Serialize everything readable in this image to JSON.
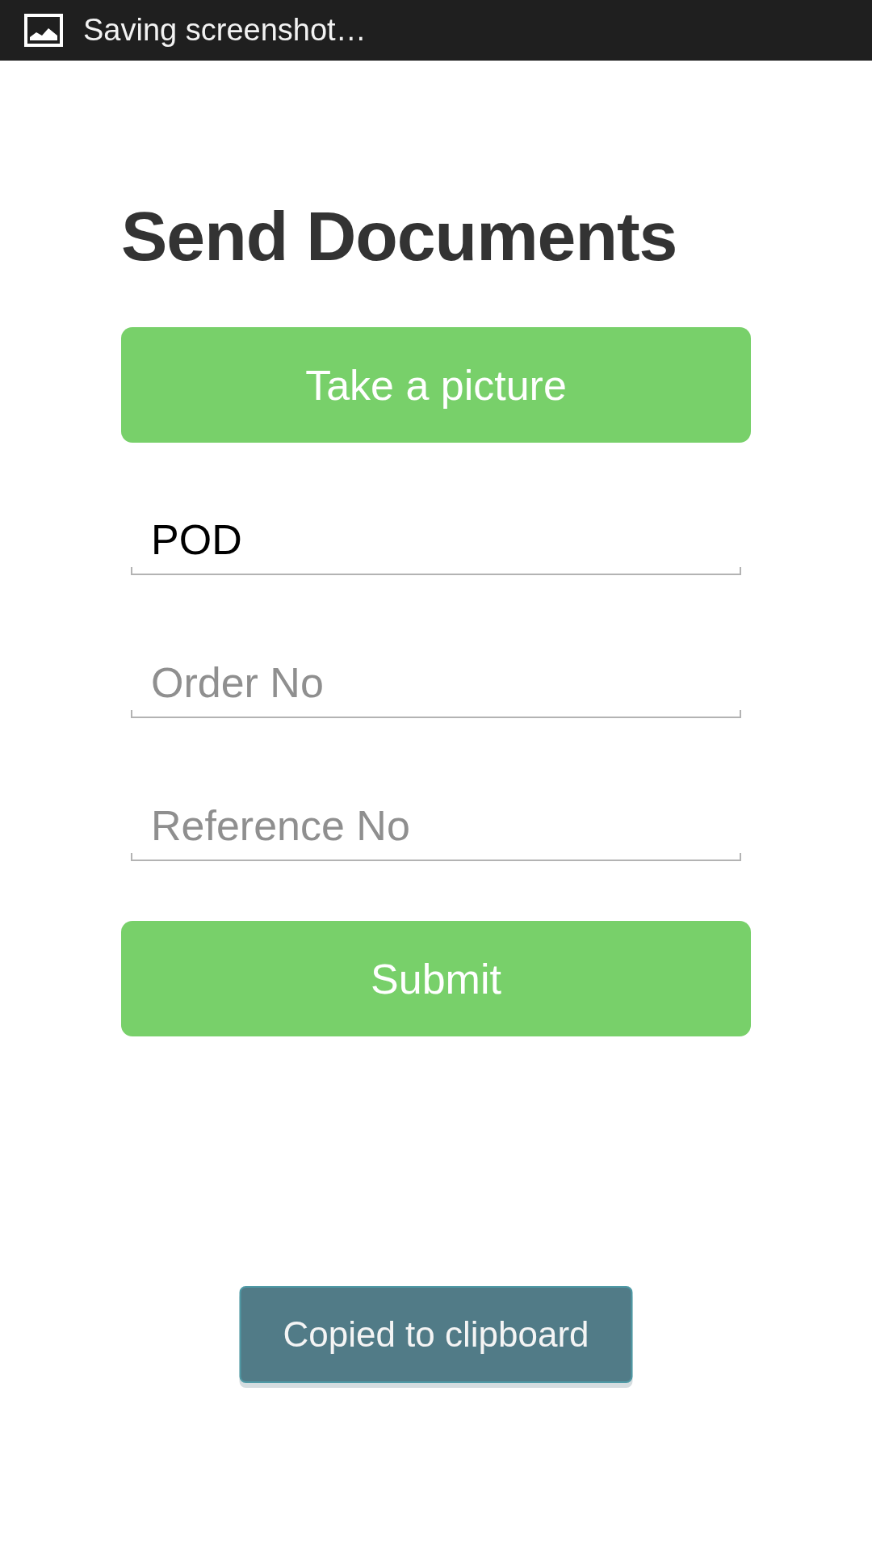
{
  "status_bar": {
    "text": "Saving screenshot…"
  },
  "title": "Send Documents",
  "take_picture_button": {
    "label": "Take a picture"
  },
  "fields": [
    {
      "value": "POD"
    },
    {
      "placeholder": "Order No"
    },
    {
      "placeholder": "Reference No"
    }
  ],
  "submit_button": {
    "label": "Submit"
  },
  "toast": {
    "text": "Copied to clipboard"
  }
}
